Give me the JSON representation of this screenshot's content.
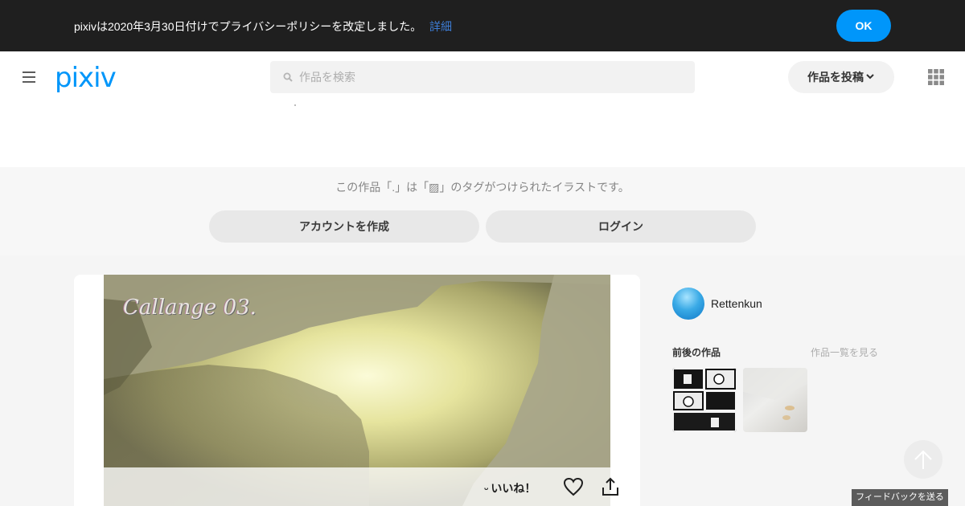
{
  "notice": {
    "text": "pixivは2020年3月30日付けでプライバシーポリシーを改定しました。",
    "link_label": "詳細",
    "ok_label": "OK"
  },
  "header": {
    "logo": "pixiv",
    "search_placeholder": "作品を検索",
    "post_label": "作品を投稿"
  },
  "signup": {
    "tag_text": "この作品「.」は「▨」のタグがつけられたイラストです。",
    "account_label": "アカウントを作成",
    "login_label": "ログイン"
  },
  "artwork": {
    "title_text": "Callange 03.",
    "like_label": "いいね！"
  },
  "sidebar": {
    "username": "Rettenkun",
    "other_works_label": "前後の作品",
    "see_all_label": "作品一覧を見る"
  },
  "footer": {
    "feedback_label": "フィードバックを送る"
  },
  "colors": {
    "accent": "#0096fa",
    "notice_bg": "#1f1f1f"
  }
}
